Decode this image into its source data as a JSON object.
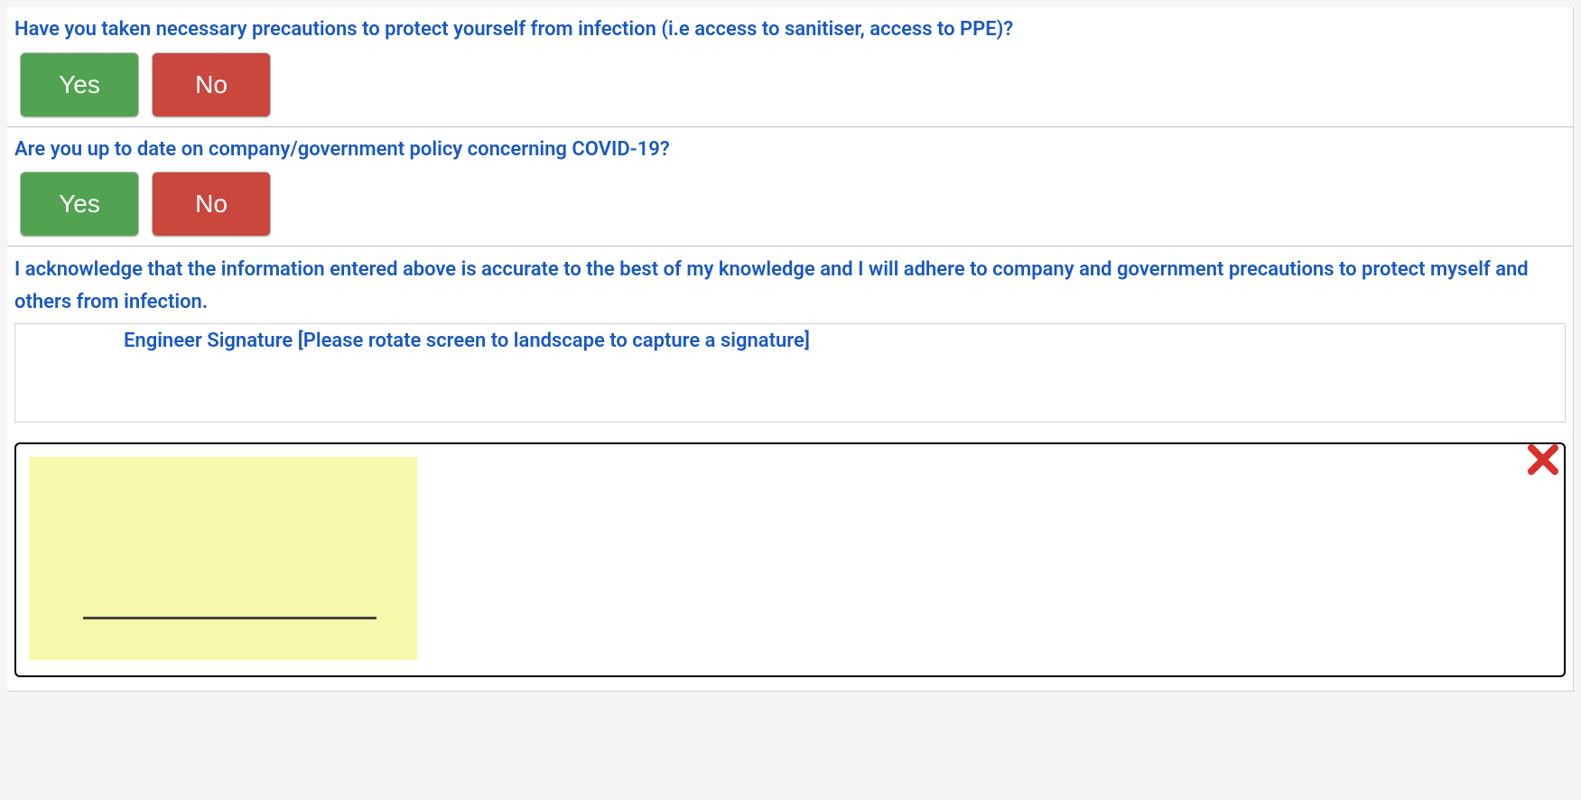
{
  "questions": [
    {
      "label": "Have you taken necessary precautions to protect yourself from infection (i.e access to sanitiser, access to PPE)?",
      "yes": "Yes",
      "no": "No"
    },
    {
      "label": "Are you up to date on company/government policy concerning COVID-19?",
      "yes": "Yes",
      "no": "No"
    }
  ],
  "acknowledgement": "I acknowledge that the information entered above is accurate to the best of my knowledge and I will adhere to company and government precautions to protect myself and others from infection.",
  "signature": {
    "label": "Engineer Signature [Please rotate screen to landscape to capture a signature]"
  },
  "colors": {
    "link_blue": "#1a59c1",
    "yes_green": "#51a351",
    "no_red": "#c9473d",
    "pad_yellow": "#f7f8ab",
    "close_red": "#d9302c"
  }
}
